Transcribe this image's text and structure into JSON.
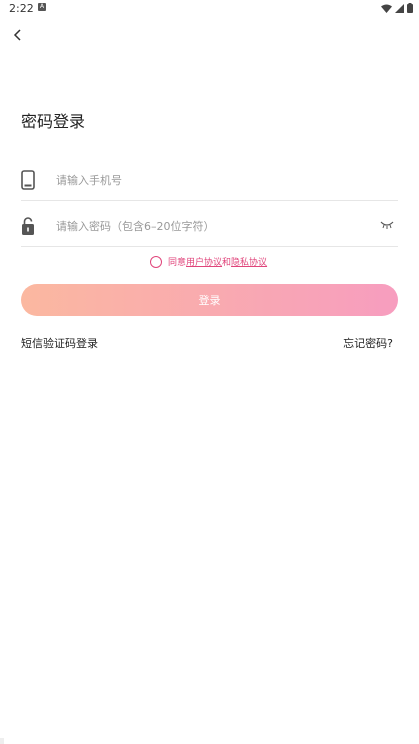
{
  "status_bar": {
    "time": "2:22",
    "notif_letter": "A"
  },
  "page": {
    "title": "密码登录"
  },
  "form": {
    "phone_placeholder": "请输入手机号",
    "password_placeholder": "请输入密码（包含6–20位字符）"
  },
  "agreement": {
    "prefix": "同意",
    "user_agreement": "用户协议",
    "and": "和",
    "privacy_policy": "隐私协议"
  },
  "buttons": {
    "login": "登录"
  },
  "links": {
    "sms_login": "短信验证码登录",
    "forgot_password": "忘记密码?"
  },
  "colors": {
    "accent": "#e0457b",
    "button_start": "#fbb8a0",
    "button_end": "#f79dbf"
  }
}
